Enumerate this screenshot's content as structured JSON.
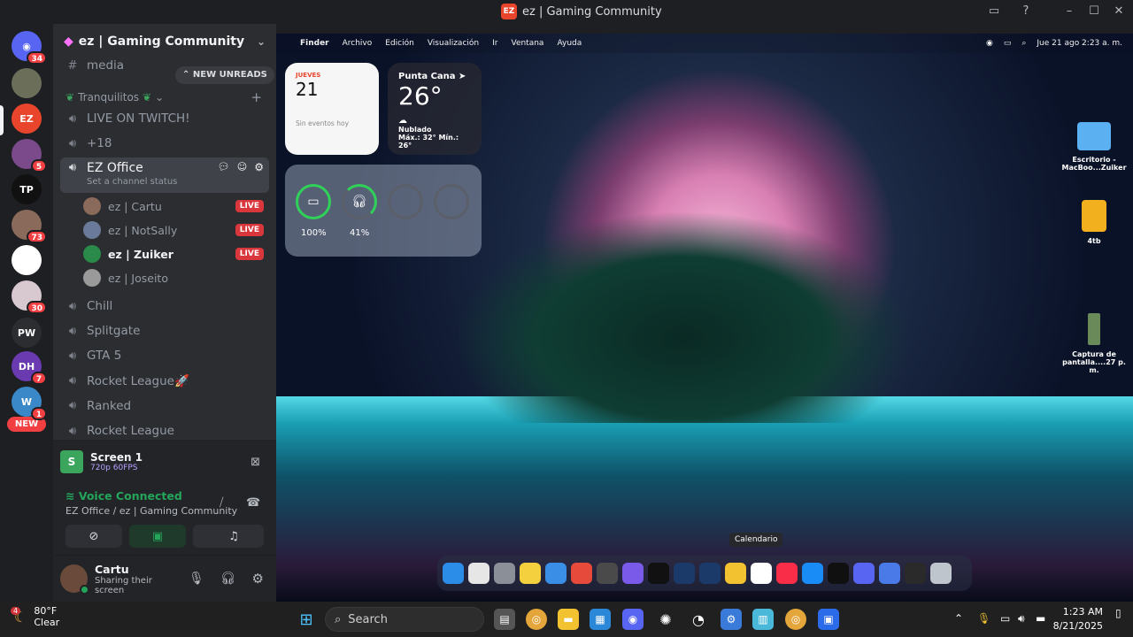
{
  "window": {
    "title": "ez | Gaming Community"
  },
  "servers": [
    {
      "name": "discord-home",
      "badge": "34",
      "color": "#5865f2",
      "label": "◉"
    },
    {
      "name": "server-2",
      "badge": "",
      "color": "#6b6f5a",
      "label": ""
    },
    {
      "name": "server-ez",
      "badge": "",
      "color": "#e8452c",
      "label": "EZ"
    },
    {
      "name": "server-4",
      "badge": "5",
      "color": "#7a4a8a",
      "label": ""
    },
    {
      "name": "server-5",
      "badge": "",
      "color": "#111111",
      "label": "TP"
    },
    {
      "name": "server-6",
      "badge": "73",
      "color": "#8a6a5a",
      "label": ""
    },
    {
      "name": "server-7",
      "badge": "",
      "color": "#ffffff",
      "label": ""
    },
    {
      "name": "server-8",
      "badge": "30",
      "color": "#d8c8d0",
      "label": ""
    },
    {
      "name": "server-patchwerk",
      "badge": "",
      "color": "#2b2d31",
      "label": "PW"
    },
    {
      "name": "server-dh",
      "badge": "7",
      "color": "#6a3ab0",
      "label": "DH"
    },
    {
      "name": "server-w",
      "badge": "1",
      "color": "#3a88c8",
      "label": "W"
    }
  ],
  "rail": {
    "new_label": "NEW"
  },
  "sidebar": {
    "guild_name": "ez | Gaming Community",
    "new_unreads": "NEW UNREADS",
    "category": "Tranquilitos",
    "channels_top": [
      {
        "name": "media",
        "type": "text"
      }
    ],
    "voice_channels_a": [
      "LIVE ON TWITCH!",
      "+18"
    ],
    "active_channel": {
      "name": "EZ Office",
      "status": "Set a channel status"
    },
    "members": [
      {
        "name": "ez | Cartu",
        "live": "LIVE",
        "bold": false
      },
      {
        "name": "ez | NotSally",
        "live": "LIVE",
        "bold": false
      },
      {
        "name": "ez | Zuiker",
        "live": "LIVE",
        "bold": true
      },
      {
        "name": "ez | Joseito",
        "live": "",
        "bold": false
      }
    ],
    "voice_channels_b": [
      "Chill",
      "Splitgate",
      "GTA 5",
      "Rocket League🚀",
      "Ranked",
      "Rocket League"
    ]
  },
  "stream": {
    "title": "Screen 1",
    "quality": "720p 60FPS"
  },
  "voice": {
    "status": "Voice Connected",
    "location": "EZ Office / ez | Gaming Community"
  },
  "user": {
    "name": "Cartu",
    "status": "Sharing their screen"
  },
  "mac": {
    "menu": [
      "Finder",
      "Archivo",
      "Edición",
      "Visualización",
      "Ir",
      "Ventana",
      "Ayuda"
    ],
    "datetime": "Jue 21 ago  2:23 a. m.",
    "calendar": {
      "weekday": "JUEVES",
      "day": "21",
      "events": "Sin eventos hoy"
    },
    "weather": {
      "city": "Punta Cana",
      "temp": "26°",
      "condition": "Nublado",
      "range": "Máx.: 32° Mín.: 26°"
    },
    "battery": [
      {
        "label": "100%",
        "level": 1.0
      },
      {
        "label": "41%",
        "level": 0.41
      }
    ],
    "desktop_icons": [
      {
        "label": "Escritorio - MacBoo...Zuiker"
      },
      {
        "label": "4tb"
      },
      {
        "label": "Captura de pantalla....27 p. m."
      }
    ],
    "tooltip": "Calendario",
    "dock_colors": [
      "#2b8de8",
      "#e6e6e6",
      "#8a8f98",
      "#f4d03f",
      "#3a8ee6",
      "#e64a3a",
      "#4a4a4a",
      "#7a5ae8",
      "#111111",
      "#1b3a6a",
      "#1b3a6a",
      "#f2c230",
      "#ffffff",
      "#fa2d48",
      "#1a8cf5",
      "#101010",
      "#5865f2",
      "#4a7ae8",
      "#2a2a2a",
      "#bfc5cc"
    ]
  },
  "taskbar": {
    "weather_temp": "80°F",
    "weather_cond": "Clear",
    "weather_badge": "4",
    "search_placeholder": "Search",
    "time": "1:23 AM",
    "date": "8/21/2025"
  }
}
